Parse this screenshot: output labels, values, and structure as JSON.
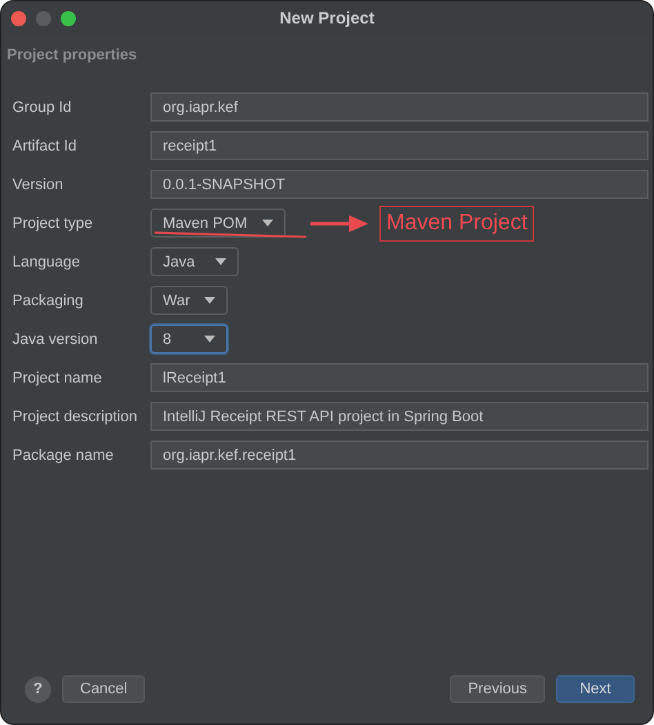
{
  "window": {
    "title": "New Project"
  },
  "section": "Project properties",
  "fields": [
    {
      "label": "Group Id",
      "kind": "text",
      "value": "org.iapr.kef",
      "focused": false
    },
    {
      "label": "Artifact Id",
      "kind": "text",
      "value": "receipt1",
      "focused": false
    },
    {
      "label": "Version",
      "kind": "text",
      "value": "0.0.1-SNAPSHOT",
      "focused": false
    },
    {
      "label": "Project type",
      "kind": "dropdown",
      "value": "Maven POM",
      "focused": false,
      "annotation": {
        "text": "Maven Project"
      }
    },
    {
      "label": "Language",
      "kind": "dropdown",
      "value": "Java",
      "focused": false
    },
    {
      "label": "Packaging",
      "kind": "dropdown",
      "value": "War",
      "focused": false
    },
    {
      "label": "Java version",
      "kind": "dropdown",
      "value": "8",
      "focused": true
    },
    {
      "label": "Project name",
      "kind": "text",
      "value": "lReceipt1",
      "focused": false
    },
    {
      "label": "Project description",
      "kind": "text",
      "value": "IntelliJ Receipt REST API project in Spring Boot",
      "focused": false
    },
    {
      "label": "Package name",
      "kind": "text",
      "value": "org.iapr.kef.receipt1",
      "focused": false
    }
  ],
  "buttons": {
    "help": "?",
    "cancel": "Cancel",
    "previous": "Previous",
    "next": "Next"
  }
}
